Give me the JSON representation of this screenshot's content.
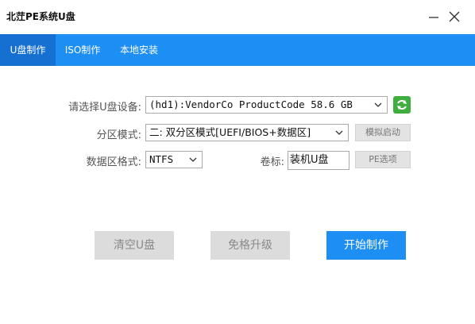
{
  "window": {
    "title": "北茳PE系统U盘",
    "minimize_icon": "minimize-icon",
    "close_icon": "close-icon"
  },
  "tabs": [
    {
      "label": "U盘制作",
      "active": true
    },
    {
      "label": "ISO制作",
      "active": false
    },
    {
      "label": "本地安装",
      "active": false
    }
  ],
  "form": {
    "device_label": "请选择U盘设备:",
    "device_value": "(hd1):VendorCo ProductCode 58.6 GB",
    "refresh_icon": "refresh-icon",
    "partition_label": "分区模式:",
    "partition_value": "二: 双分区模式[UEFI/BIOS+数据区]",
    "simulate_button": "模拟启动",
    "format_label": "数据区格式:",
    "format_value": "NTFS",
    "volume_label": "卷标:",
    "volume_value": "装机U盘",
    "pe_options_button": "PE选项"
  },
  "actions": {
    "clear_button": "清空U盘",
    "upgrade_button": "免格升级",
    "start_button": "开始制作"
  },
  "colors": {
    "accent": "#1d8ef3",
    "active_tab": "#1670d2",
    "refresh": "#3fae3f"
  }
}
